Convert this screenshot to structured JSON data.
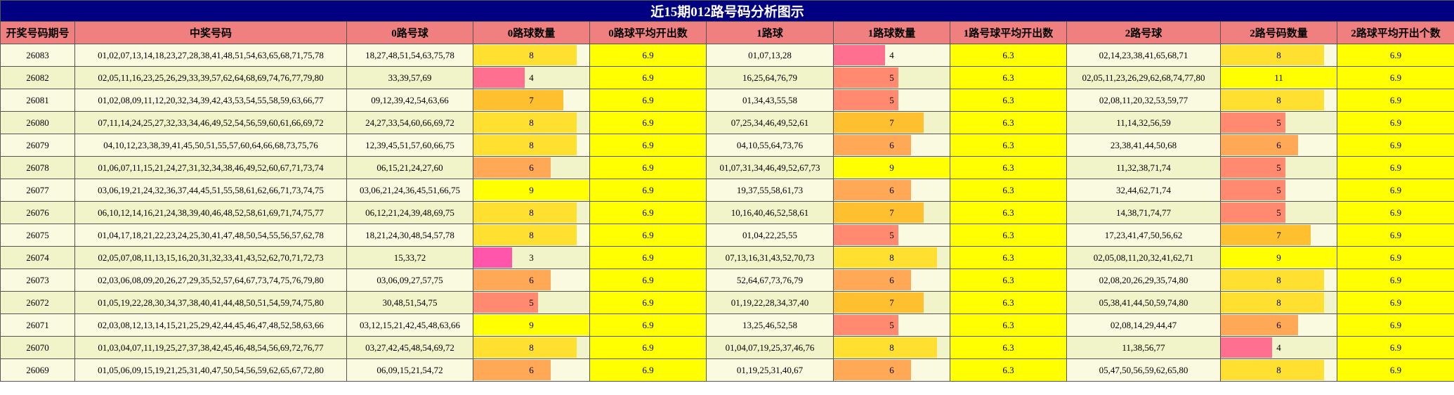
{
  "title": "近15期012路号码分析图示",
  "headers": [
    "开奖号码期号",
    "中奖号码",
    "0路号球",
    "0路球数量",
    "0路球平均开出数",
    "1路球",
    "1路球数量",
    "1路号球平均开出数",
    "2路号球",
    "2路号码数量",
    "2路球平均开出个数"
  ],
  "rows": [
    {
      "period": "26083",
      "numbers": "01,02,07,13,14,18,23,27,28,38,41,48,51,54,63,65,68,71,75,78",
      "r0": "18,27,48,51,54,63,75,78",
      "c0": 8,
      "a0": "6.9",
      "r1": "01,07,13,28",
      "c1": 4,
      "a1": "6.3",
      "r2": "02,14,23,38,41,65,68,71",
      "c2": 8,
      "a2": "6.9"
    },
    {
      "period": "26082",
      "numbers": "02,05,11,16,23,25,26,29,33,39,57,62,64,68,69,74,76,77,79,80",
      "r0": "33,39,57,69",
      "c0": 4,
      "a0": "6.9",
      "r1": "16,25,64,76,79",
      "c1": 5,
      "a1": "6.3",
      "r2": "02,05,11,23,26,29,62,68,74,77,80",
      "c2": 11,
      "a2": "6.9"
    },
    {
      "period": "26081",
      "numbers": "01,02,08,09,11,12,20,32,34,39,42,43,53,54,55,58,59,63,66,77",
      "r0": "09,12,39,42,54,63,66",
      "c0": 7,
      "a0": "6.9",
      "r1": "01,34,43,55,58",
      "c1": 5,
      "a1": "6.3",
      "r2": "02,08,11,20,32,53,59,77",
      "c2": 8,
      "a2": "6.9"
    },
    {
      "period": "26080",
      "numbers": "07,11,14,24,25,27,32,33,34,46,49,52,54,56,59,60,61,66,69,72",
      "r0": "24,27,33,54,60,66,69,72",
      "c0": 8,
      "a0": "6.9",
      "r1": "07,25,34,46,49,52,61",
      "c1": 7,
      "a1": "6.3",
      "r2": "11,14,32,56,59",
      "c2": 5,
      "a2": "6.9"
    },
    {
      "period": "26079",
      "numbers": "04,10,12,23,38,39,41,45,50,51,55,57,60,64,66,68,73,75,76",
      "r0": "12,39,45,51,57,60,66,75",
      "c0": 8,
      "a0": "6.9",
      "r1": "04,10,55,64,73,76",
      "c1": 6,
      "a1": "6.3",
      "r2": "23,38,41,44,50,68",
      "c2": 6,
      "a2": "6.9"
    },
    {
      "period": "26078",
      "numbers": "01,06,07,11,15,21,24,27,31,32,34,38,46,49,52,60,67,71,73,74",
      "r0": "06,15,21,24,27,60",
      "c0": 6,
      "a0": "6.9",
      "r1": "01,07,31,34,46,49,52,67,73",
      "c1": 9,
      "a1": "6.3",
      "r2": "11,32,38,71,74",
      "c2": 5,
      "a2": "6.9"
    },
    {
      "period": "26077",
      "numbers": "03,06,19,21,24,32,36,37,44,45,51,55,58,61,62,66,71,73,74,75",
      "r0": "03,06,21,24,36,45,51,66,75",
      "c0": 9,
      "a0": "6.9",
      "r1": "19,37,55,58,61,73",
      "c1": 6,
      "a1": "6.3",
      "r2": "32,44,62,71,74",
      "c2": 5,
      "a2": "6.9"
    },
    {
      "period": "26076",
      "numbers": "06,10,12,14,16,21,24,38,39,40,46,48,52,58,61,69,71,74,75,77",
      "r0": "06,12,21,24,39,48,69,75",
      "c0": 8,
      "a0": "6.9",
      "r1": "10,16,40,46,52,58,61",
      "c1": 7,
      "a1": "6.3",
      "r2": "14,38,71,74,77",
      "c2": 5,
      "a2": "6.9"
    },
    {
      "period": "26075",
      "numbers": "01,04,17,18,21,22,23,24,25,30,41,47,48,50,54,55,56,57,62,78",
      "r0": "18,21,24,30,48,54,57,78",
      "c0": 8,
      "a0": "6.9",
      "r1": "01,04,22,25,55",
      "c1": 5,
      "a1": "6.3",
      "r2": "17,23,41,47,50,56,62",
      "c2": 7,
      "a2": "6.9"
    },
    {
      "period": "26074",
      "numbers": "02,05,07,08,11,13,15,16,20,31,32,33,41,43,52,62,70,71,72,73",
      "r0": "15,33,72",
      "c0": 3,
      "a0": "6.9",
      "r1": "07,13,16,31,43,52,70,73",
      "c1": 8,
      "a1": "6.3",
      "r2": "02,05,08,11,20,32,41,62,71",
      "c2": 9,
      "a2": "6.9"
    },
    {
      "period": "26073",
      "numbers": "02,03,06,08,09,20,26,27,29,35,52,57,64,67,73,74,75,76,79,80",
      "r0": "03,06,09,27,57,75",
      "c0": 6,
      "a0": "6.9",
      "r1": "52,64,67,73,76,79",
      "c1": 6,
      "a1": "6.3",
      "r2": "02,08,20,26,29,35,74,80",
      "c2": 8,
      "a2": "6.9"
    },
    {
      "period": "26072",
      "numbers": "01,05,19,22,28,30,34,37,38,40,41,44,48,50,51,54,59,74,75,80",
      "r0": "30,48,51,54,75",
      "c0": 5,
      "a0": "6.9",
      "r1": "01,19,22,28,34,37,40",
      "c1": 7,
      "a1": "6.3",
      "r2": "05,38,41,44,50,59,74,80",
      "c2": 8,
      "a2": "6.9"
    },
    {
      "period": "26071",
      "numbers": "02,03,08,12,13,14,15,21,25,29,42,44,45,46,47,48,52,58,63,66",
      "r0": "03,12,15,21,42,45,48,63,66",
      "c0": 9,
      "a0": "6.9",
      "r1": "13,25,46,52,58",
      "c1": 5,
      "a1": "6.3",
      "r2": "02,08,14,29,44,47",
      "c2": 6,
      "a2": "6.9"
    },
    {
      "period": "26070",
      "numbers": "01,03,04,07,11,19,25,27,37,38,42,45,46,48,54,56,69,72,76,77",
      "r0": "03,27,42,45,48,54,69,72",
      "c0": 8,
      "a0": "6.9",
      "r1": "01,04,07,19,25,37,46,76",
      "c1": 8,
      "a1": "6.3",
      "r2": "11,38,56,77",
      "c2": 4,
      "a2": "6.9"
    },
    {
      "period": "26069",
      "numbers": "01,05,06,09,15,19,21,25,31,40,47,50,54,56,59,62,65,67,72,80",
      "r0": "06,09,15,21,54,72",
      "c0": 6,
      "a0": "6.9",
      "r1": "01,19,25,31,40,67",
      "c1": 6,
      "a1": "6.3",
      "r2": "05,47,50,56,59,62,65,80",
      "c2": 8,
      "a2": "6.9"
    }
  ],
  "colors": {
    "title_bg": "#000080",
    "header_bg": "#f08080",
    "avg_bg": "#ffff00",
    "row_odd": "#fafae0",
    "row_even": "#f0f4c8"
  }
}
